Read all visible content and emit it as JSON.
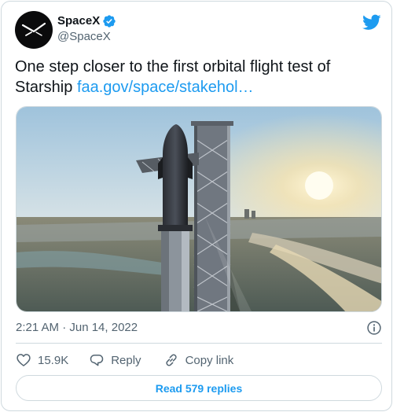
{
  "account": {
    "display_name": "SpaceX",
    "handle": "@SpaceX",
    "verified": true,
    "avatar_icon": "spacex-logo-icon"
  },
  "brand_icon": "twitter-bird-icon",
  "tweet": {
    "text": "One step closer to the first orbital flight test of Starship ",
    "link_text": "faa.gov/space/stakehol…"
  },
  "media": {
    "icon": "starship-launch-tower-photo",
    "description_hidden": true
  },
  "meta": {
    "timestamp": "2:21 AM · Jun 14, 2022",
    "info_icon": "info-icon"
  },
  "actions": {
    "like_count": "15.9K",
    "reply_label": "Reply",
    "copy_link_label": "Copy link"
  },
  "read_replies_label": "Read 579 replies",
  "colors": {
    "accent": "#1d9bf0",
    "text": "#0f1419",
    "secondary": "#536471",
    "border": "#cfd9de"
  }
}
